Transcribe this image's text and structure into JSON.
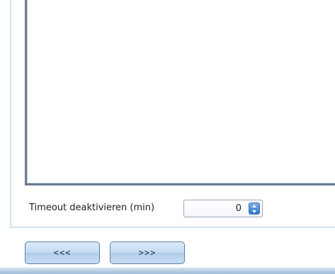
{
  "timeout": {
    "label": "Timeout deaktivieren (min)",
    "value": "0"
  },
  "navigation": {
    "prev_label": "<<<",
    "next_label": ">>>"
  },
  "colors": {
    "list_border": "#6b7c93",
    "panel_border": "#cfe3ec",
    "spinner_button": "#2f73c9",
    "nav_button": "#c5dbf2"
  }
}
